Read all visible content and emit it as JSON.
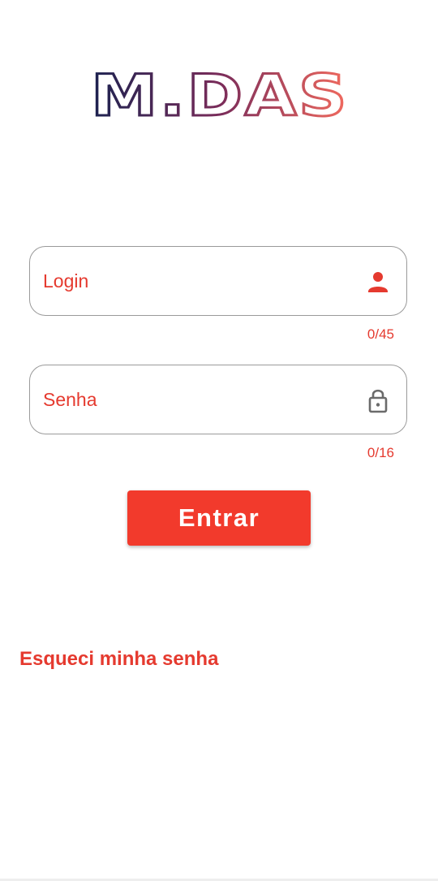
{
  "app": {
    "logo_text": "M.DAS",
    "logo_gradient": [
      "#1b2250",
      "#7a2c5a",
      "#f26a5e"
    ]
  },
  "login_field": {
    "placeholder": "Login",
    "value": "",
    "counter": "0/45",
    "icon": "person-icon"
  },
  "password_field": {
    "placeholder": "Senha",
    "value": "",
    "counter": "0/16",
    "icon": "lock-icon"
  },
  "submit_button": {
    "label": "Entrar"
  },
  "forgot_password": {
    "label": "Esqueci minha senha"
  },
  "colors": {
    "accent": "#e53a2f",
    "button": "#f23a2c",
    "field_border": "#9a9a9a",
    "lock_icon": "#6b6b6b"
  }
}
